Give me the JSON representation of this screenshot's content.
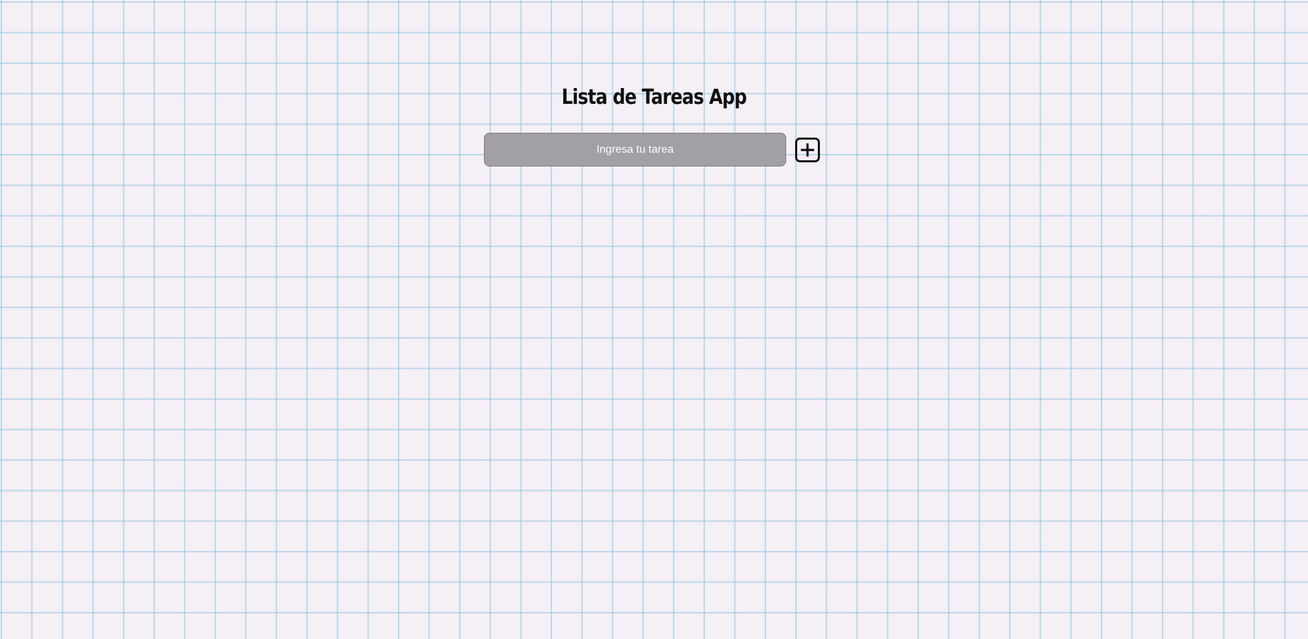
{
  "header": {
    "title": "Lista de Tareas App"
  },
  "task_form": {
    "input_value": "",
    "input_placeholder": "Ingresa tu tarea",
    "add_button_icon": "plus-square-icon"
  },
  "colors": {
    "input_background": "#a2a0a4",
    "grid_line": "#8cc3e1",
    "paper_background": "#f5eff6",
    "title_text": "#111111"
  }
}
